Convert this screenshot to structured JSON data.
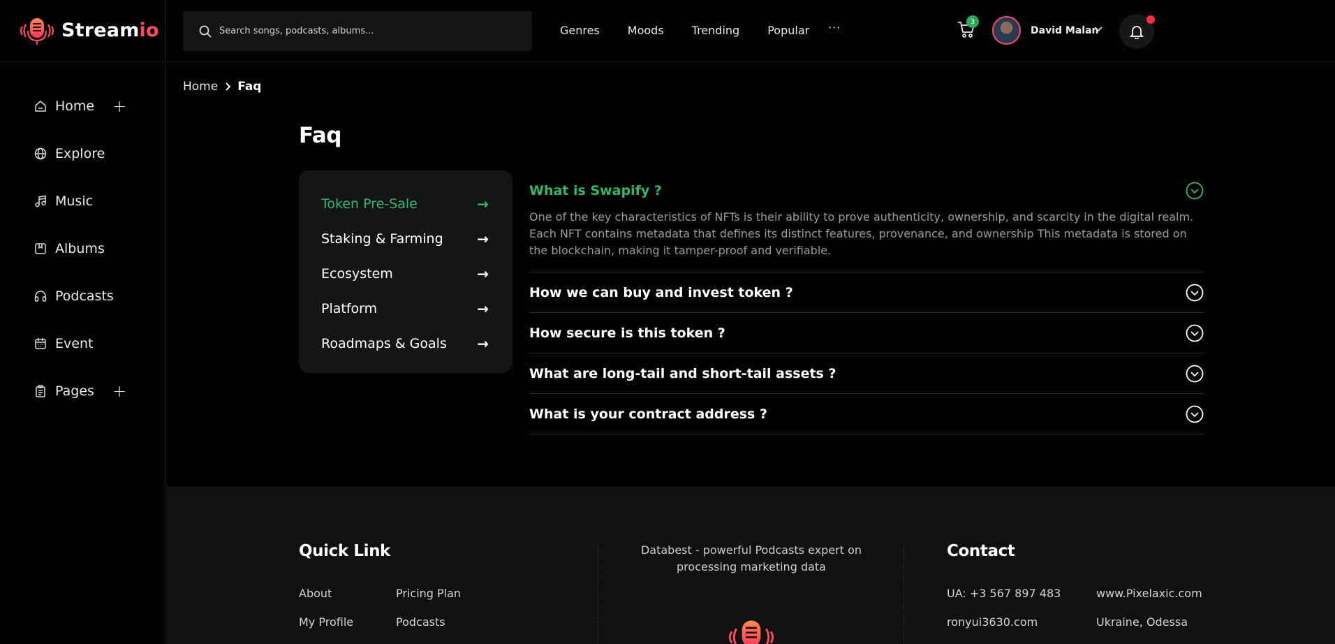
{
  "brand": {
    "name_part1": "Stream",
    "name_part2": "io",
    "accent_color": "#ff4b5f"
  },
  "sidebar": {
    "items": [
      {
        "label": "Home",
        "icon": "home-icon",
        "expandable": true
      },
      {
        "label": "Explore",
        "icon": "globe-icon",
        "expandable": false
      },
      {
        "label": "Music",
        "icon": "music-note-icon",
        "expandable": false
      },
      {
        "label": "Albums",
        "icon": "album-icon",
        "expandable": false
      },
      {
        "label": "Podcasts",
        "icon": "headphones-icon",
        "expandable": false
      },
      {
        "label": "Event",
        "icon": "calendar-icon",
        "expandable": false
      },
      {
        "label": "Pages",
        "icon": "clipboard-icon",
        "expandable": true
      }
    ],
    "expand_symbol": "+"
  },
  "header": {
    "search_placeholder": "Search songs, podcasts, albums...",
    "nav": [
      "Genres",
      "Moods",
      "Trending",
      "Popular"
    ],
    "more": "···",
    "cart_count": "3",
    "user_name": "David Malan"
  },
  "breadcrumb": {
    "home": "Home",
    "current": "Faq"
  },
  "page_title": "Faq",
  "categories": [
    {
      "label": "Token Pre-Sale",
      "active": true
    },
    {
      "label": "Staking & Farming",
      "active": false
    },
    {
      "label": "Ecosystem",
      "active": false
    },
    {
      "label": "Platform",
      "active": false
    },
    {
      "label": "Roadmaps & Goals",
      "active": false
    }
  ],
  "category_arrow": "→",
  "faq": [
    {
      "question": "What is Swapify ?",
      "open": true,
      "answer": "One of the key characteristics of NFTs is their ability to prove authenticity, ownership, and scarcity in the digital realm. Each NFT contains metadata that defines its distinct features, provenance, and ownership This metadata is stored on the blockchain, making it tamper-proof and verifiable."
    },
    {
      "question": "How we can buy and invest token ?",
      "open": false
    },
    {
      "question": "How secure is this token ?",
      "open": false
    },
    {
      "question": "What are long-tail and short-tail assets ?",
      "open": false
    },
    {
      "question": "What is your contract address ?",
      "open": false
    }
  ],
  "footer": {
    "quick_link_title": "Quick Link",
    "links_col1": [
      "About",
      "My Profile"
    ],
    "links_col2": [
      "Pricing Plan",
      "Podcasts"
    ],
    "description": "Databest - powerful Podcasts expert on processing marketing data",
    "contact_title": "Contact",
    "contact_col1": [
      "UA: +3 567 897 483",
      "ronyui3630.com"
    ],
    "contact_col2": [
      "www.Pixelaxic.com",
      "Ukraine, Odessa"
    ]
  },
  "colors": {
    "active_green": "#31b86d",
    "panel": "#141616",
    "background": "#030303"
  }
}
